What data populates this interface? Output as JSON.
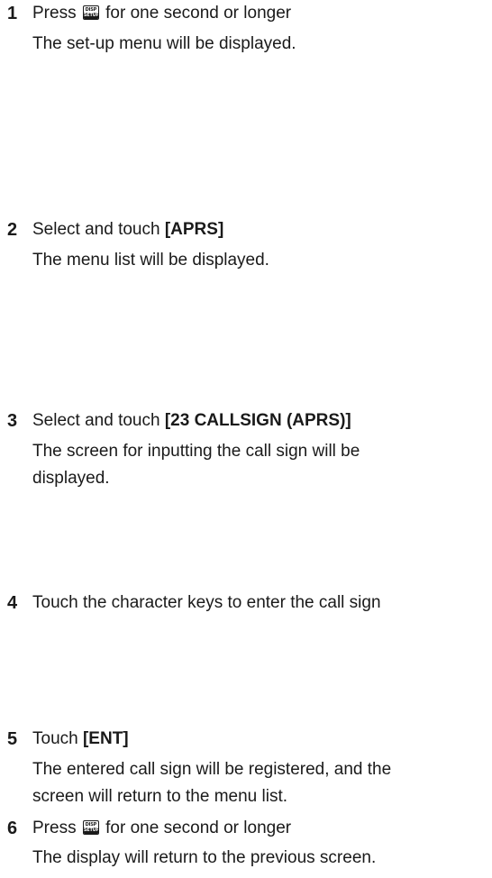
{
  "steps": [
    {
      "number": "1",
      "title_prefix": "Press",
      "key": {
        "top": "DISP",
        "bottom": "SETUP",
        "icon": "disp-setup-key-icon"
      },
      "title_suffix": "for one second or longer",
      "desc": [
        "The set-up menu will be displayed."
      ]
    },
    {
      "number": "2",
      "title_prefix": "Select and touch",
      "title_bold": "[APRS]",
      "desc": [
        "The menu list will be displayed."
      ]
    },
    {
      "number": "3",
      "title_prefix": "Select and touch",
      "title_bold": "[23 CALLSIGN (APRS)]",
      "desc": [
        "The screen for inputting the call sign will be",
        "displayed."
      ]
    },
    {
      "number": "4",
      "title": "Touch the character keys to enter the call sign"
    },
    {
      "number": "5",
      "title_prefix": "Touch",
      "title_bold": "[ENT]",
      "desc": [
        "The entered call sign will be registered, and the",
        "screen will return to the menu list."
      ]
    },
    {
      "number": "6",
      "title_prefix": "Press",
      "key": {
        "top": "DISP",
        "bottom": "SETUP",
        "icon": "disp-setup-key-icon"
      },
      "title_suffix": "for one second or longer",
      "desc": [
        "The display will return to the previous screen."
      ]
    }
  ]
}
